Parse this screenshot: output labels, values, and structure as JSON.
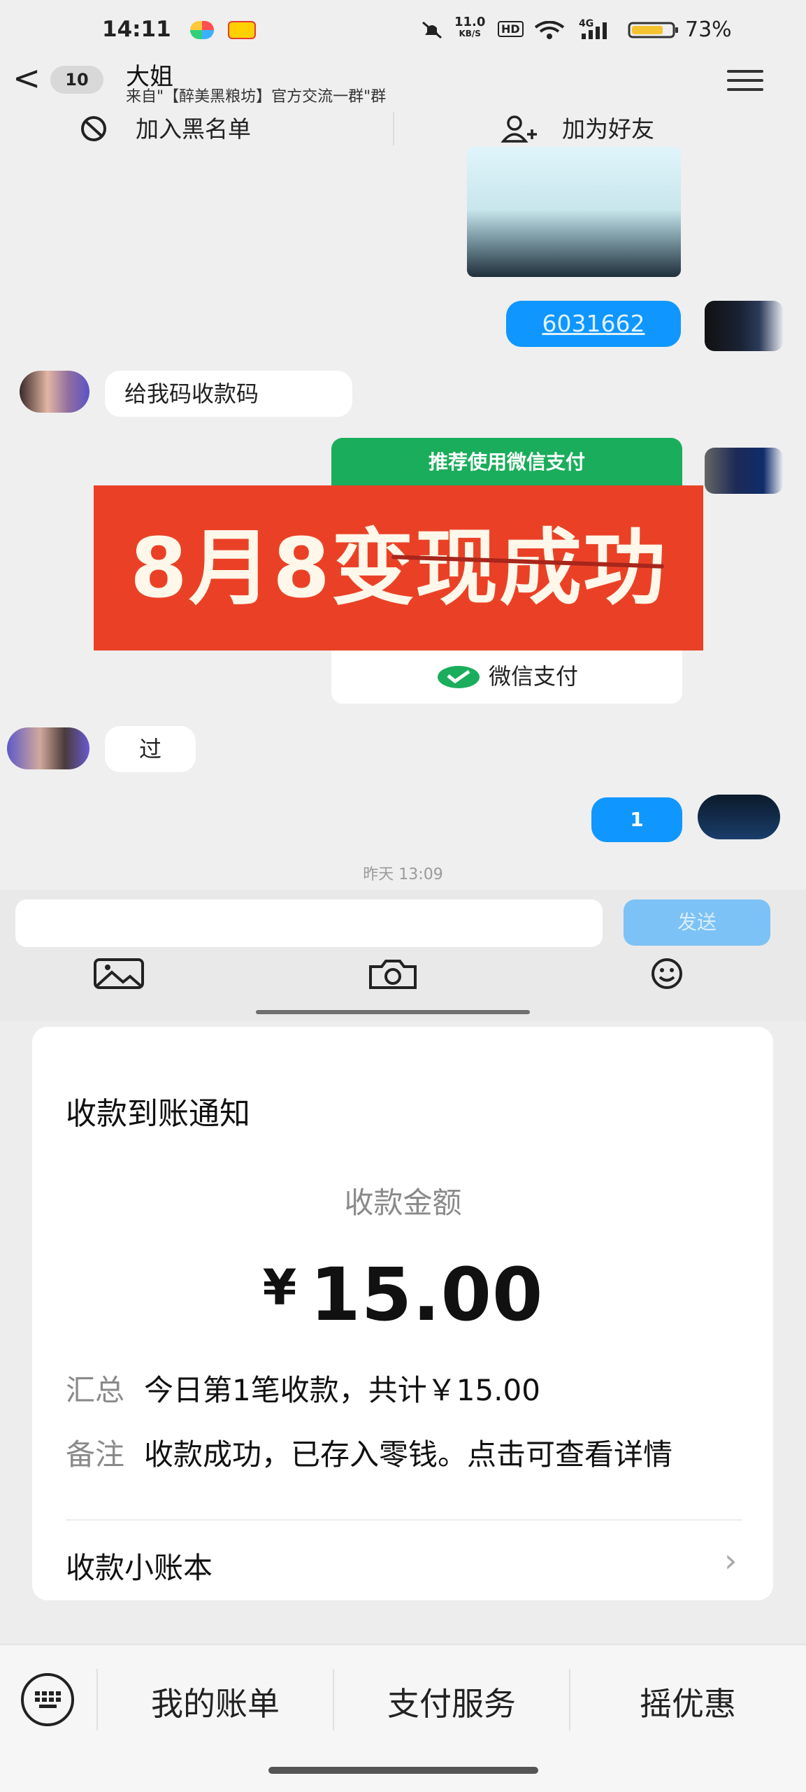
{
  "status_bar": {
    "time": "14:11",
    "network_speed": "11.0",
    "network_unit": "KB/S",
    "hd": "HD",
    "signal": "4G",
    "battery_percent": "73%",
    "icons": [
      "mute-bell-icon",
      "wifi-icon",
      "signal-icon",
      "battery-icon"
    ]
  },
  "chat_header": {
    "back_label": "<",
    "unread_count": "10",
    "contact_name": "大姐",
    "source_text": "来自\"【醉美黑粮坊】官方交流一群\"群",
    "menu_icon": "hamburger-icon"
  },
  "chat_actions": {
    "blacklist": "加入黑名单",
    "add_friend": "加为好友"
  },
  "messages": {
    "link_number": "6031662",
    "request_text": "给我码收款码",
    "pay_card_header": "推荐使用微信支付",
    "pay_card_footer": "微信支付",
    "reply_text": "过",
    "one_text": "1",
    "timestamp": "昨天 13:09"
  },
  "promo_banner": {
    "text": "8月8变现成功"
  },
  "chat_input": {
    "placeholder": "",
    "send_label": "发送",
    "tools": [
      "image-icon",
      "camera-icon",
      "emoji-icon"
    ]
  },
  "notification": {
    "title": "收款到账通知",
    "amount_label": "收款金额",
    "currency": "¥",
    "amount": "15.00",
    "summary_label": "汇总",
    "summary_value": "今日第1笔收款，共计￥15.00",
    "remark_label": "备注",
    "remark_value": "收款成功，已存入零钱。点击可查看详情",
    "ledger_label": "收款小账本"
  },
  "bottom_bar": {
    "keyboard_icon": "keyboard-icon",
    "items": [
      "我的账单",
      "支付服务",
      "摇优惠"
    ]
  },
  "colors": {
    "wechat_green": "#1aad5b",
    "bubble_blue": "#1096ff",
    "promo_red": "#ea4126"
  }
}
